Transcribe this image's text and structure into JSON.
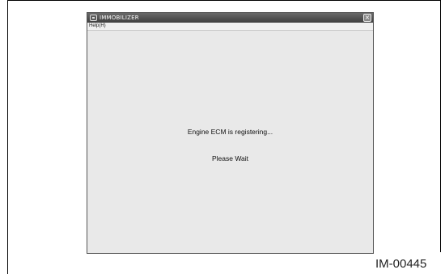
{
  "window": {
    "title": "IMMOBILIZER",
    "close_symbol": "×",
    "app_icon": "app-icon"
  },
  "menu": {
    "items": [
      {
        "label": "Help(H)"
      }
    ]
  },
  "main": {
    "status_message": "Engine ECM is registering...",
    "wait_message": "Please Wait"
  },
  "figure_id": "IM-00445"
}
